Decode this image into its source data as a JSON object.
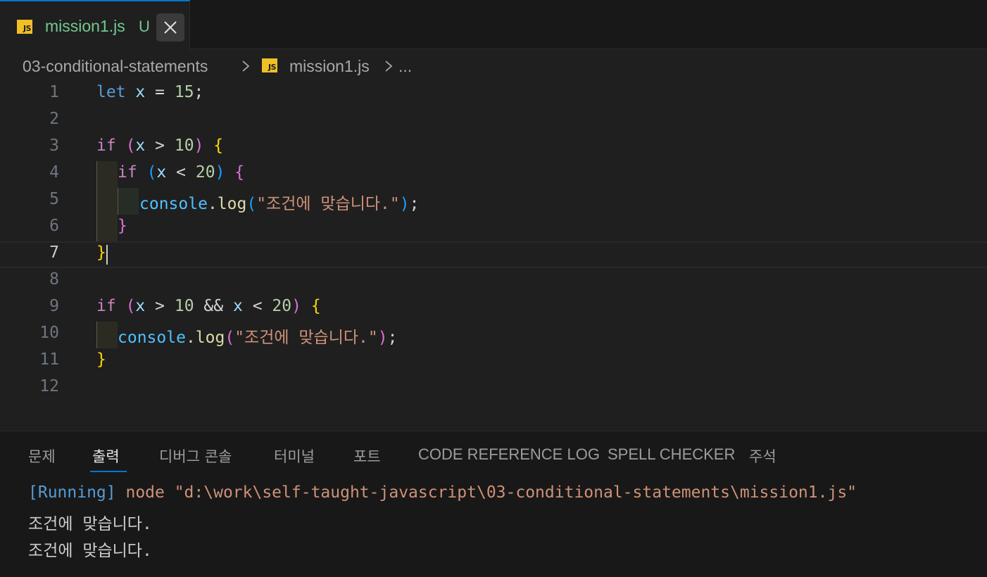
{
  "tab": {
    "icon": "js-file-icon",
    "icon_text": "JS",
    "filename": "mission1.js",
    "status": "U",
    "close_icon": "close-icon"
  },
  "breadcrumb": {
    "folder": "03-conditional-statements",
    "file": "mission1.js",
    "more": "..."
  },
  "editor": {
    "current_line": 7,
    "line_numbers": [
      "1",
      "2",
      "3",
      "4",
      "5",
      "6",
      "7",
      "8",
      "9",
      "10",
      "11",
      "12"
    ]
  },
  "panel": {
    "tabs": [
      "문제",
      "출력",
      "디버그 콘솔",
      "터미널",
      "포트",
      "CODE REFERENCE LOG",
      "SPELL CHECKER",
      "주석"
    ],
    "active_tab": "출력",
    "output": {
      "running_tag": "[Running]",
      "command": " node \"d:\\work\\self-taught-javascript\\03-conditional-statements\\mission1.js\"",
      "lines": [
        "조건에 맞습니다.",
        "조건에 맞습니다."
      ]
    }
  },
  "colors": {
    "accent": "#0078d4",
    "untracked": "#73c991",
    "js_badge": "#f1bf26"
  }
}
